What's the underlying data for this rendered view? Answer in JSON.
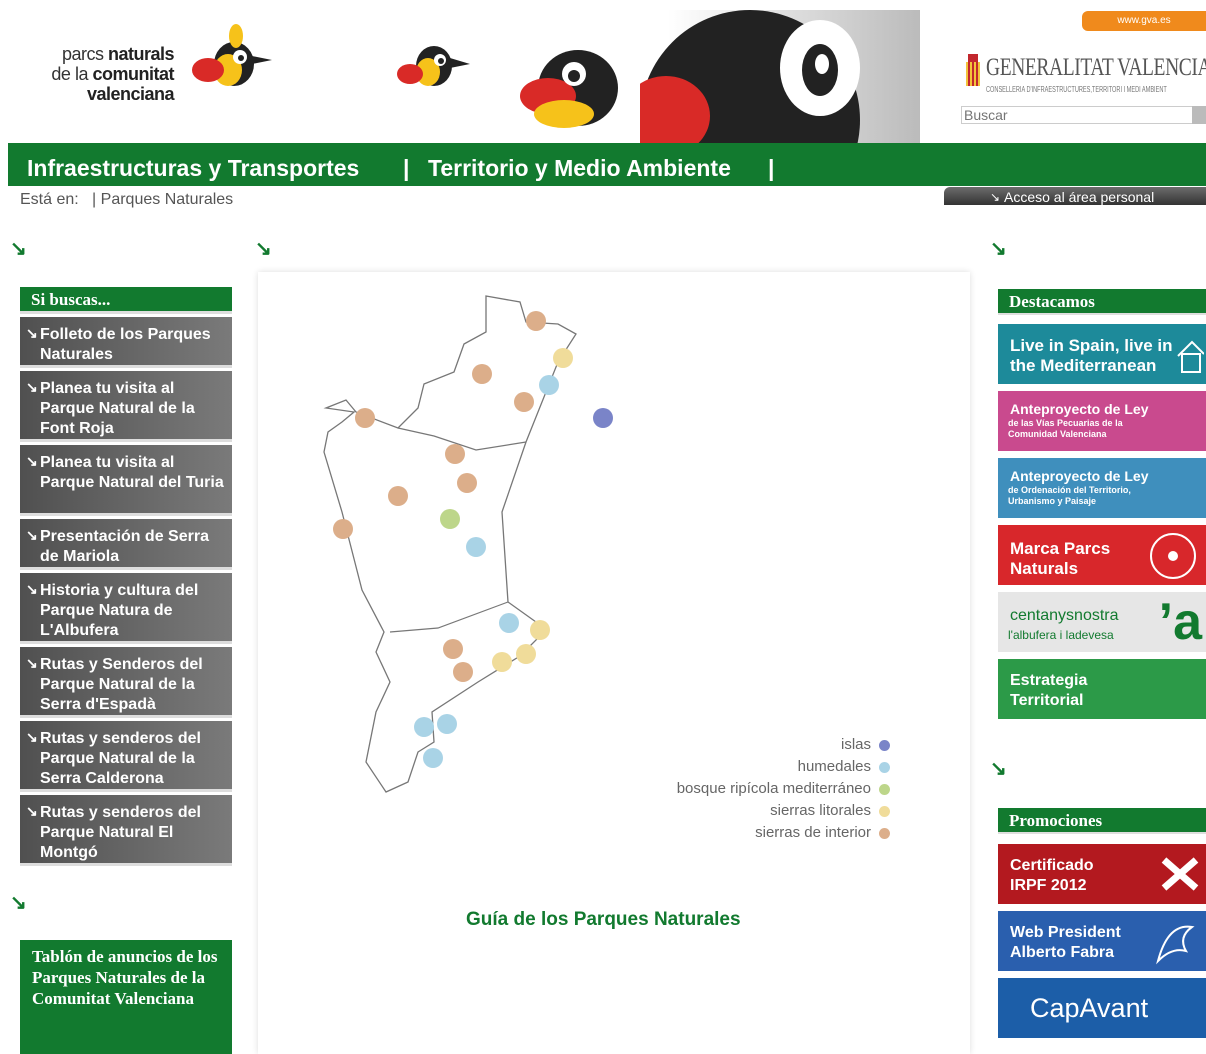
{
  "header": {
    "logo_line1_light": "parcs",
    "logo_line1_bold": "naturals",
    "logo_line2_light": "de la",
    "logo_line2_bold": "comunitat",
    "logo_line3": "valenciana",
    "gva_link": "www.gva.es",
    "gov_title": "GENERALITAT VALENCIANA",
    "gov_subtitle": "CONSELLERIA D'INFRAESTRUCTURES,TERRITORI I MEDI AMBIENT",
    "search_placeholder": "Buscar"
  },
  "nav": {
    "item1": "Infraestructuras y Transportes",
    "sep": "|",
    "item2": "Territorio y Medio Ambiente"
  },
  "breadcrumb": {
    "label": "Está en:",
    "path": "| Parques Naturales"
  },
  "personal_access": "Acceso al área personal",
  "left": {
    "box_title": "Si buscas...",
    "items": [
      "Folleto de los Parques Naturales",
      "Planea tu visita al Parque Natural de la Font Roja",
      "Planea tu visita al Parque Natural del Turia",
      "Presentación de Serra de Mariola",
      "Historia y cultura del Parque Natura de L'Albufera",
      "Rutas y Senderos del Parque Natural de la Serra d'Espadà",
      "Rutas y senderos del Parque Natural de la Serra Calderona",
      "Rutas y senderos del Parque Natural El Montgó"
    ],
    "tablon": "Tablón de anuncios de los Parques Naturales de la Comunitat Valenciana"
  },
  "main": {
    "legend": [
      {
        "label": "islas",
        "color": "#7a84c8"
      },
      {
        "label": "humedales",
        "color": "#a9d3e6"
      },
      {
        "label": "bosque ripícola mediterráneo",
        "color": "#bdd68a"
      },
      {
        "label": "sierras litorales",
        "color": "#f0dc9a"
      },
      {
        "label": "sierras de interior",
        "color": "#dcae8a"
      }
    ],
    "guide_link": "Guía de los Parques Naturales"
  },
  "right": {
    "destacamos_title": "Destacamos",
    "destacamos": [
      {
        "title": "Live in Spain, live in the Mediterranean",
        "sub": "",
        "color": "#1d8a9a"
      },
      {
        "title": "Anteproyecto de Ley",
        "sub": "de las Vías Pecuarias de la Comunidad Valenciana",
        "color": "#c94a8e"
      },
      {
        "title": "Anteproyecto de Ley",
        "sub": "de Ordenación del Territorio, Urbanismo y Paisaje",
        "color": "#3f8fbd"
      },
      {
        "title": "Marca Parcs Naturals",
        "sub": "",
        "color": "#d8272b"
      },
      {
        "title": "centanysnostra",
        "sub": "l'albufera i ladevesa",
        "color": "#e6e6e6"
      },
      {
        "title": "Estrategia Territorial",
        "sub": "",
        "color": "#2c9a48"
      }
    ],
    "promociones_title": "Promociones",
    "promociones": [
      {
        "title": "Certificado IRPF 2012",
        "color": "#b3191f"
      },
      {
        "title": "Web President Alberto Fabra",
        "color": "#2a5fae"
      },
      {
        "title": "CapAvant",
        "color": "#1c5ea8"
      }
    ]
  }
}
